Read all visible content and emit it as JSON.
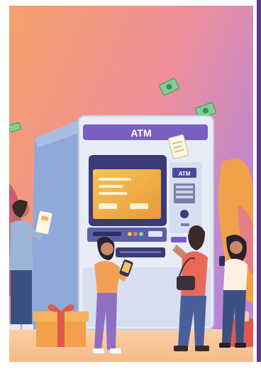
{
  "illustration": {
    "atm_sign": "ATM",
    "atm_card_slot_label": "ATM"
  },
  "colors": {
    "sky_top": "#e98aa0",
    "sky_mid": "#f4a56a",
    "sky_right": "#b07bd0",
    "floor": "#f7c99a",
    "atm_body": "#dfe6f4",
    "atm_purple": "#7a5fc2",
    "screen": "#f1b24a",
    "money_green": "#6fbf86"
  }
}
